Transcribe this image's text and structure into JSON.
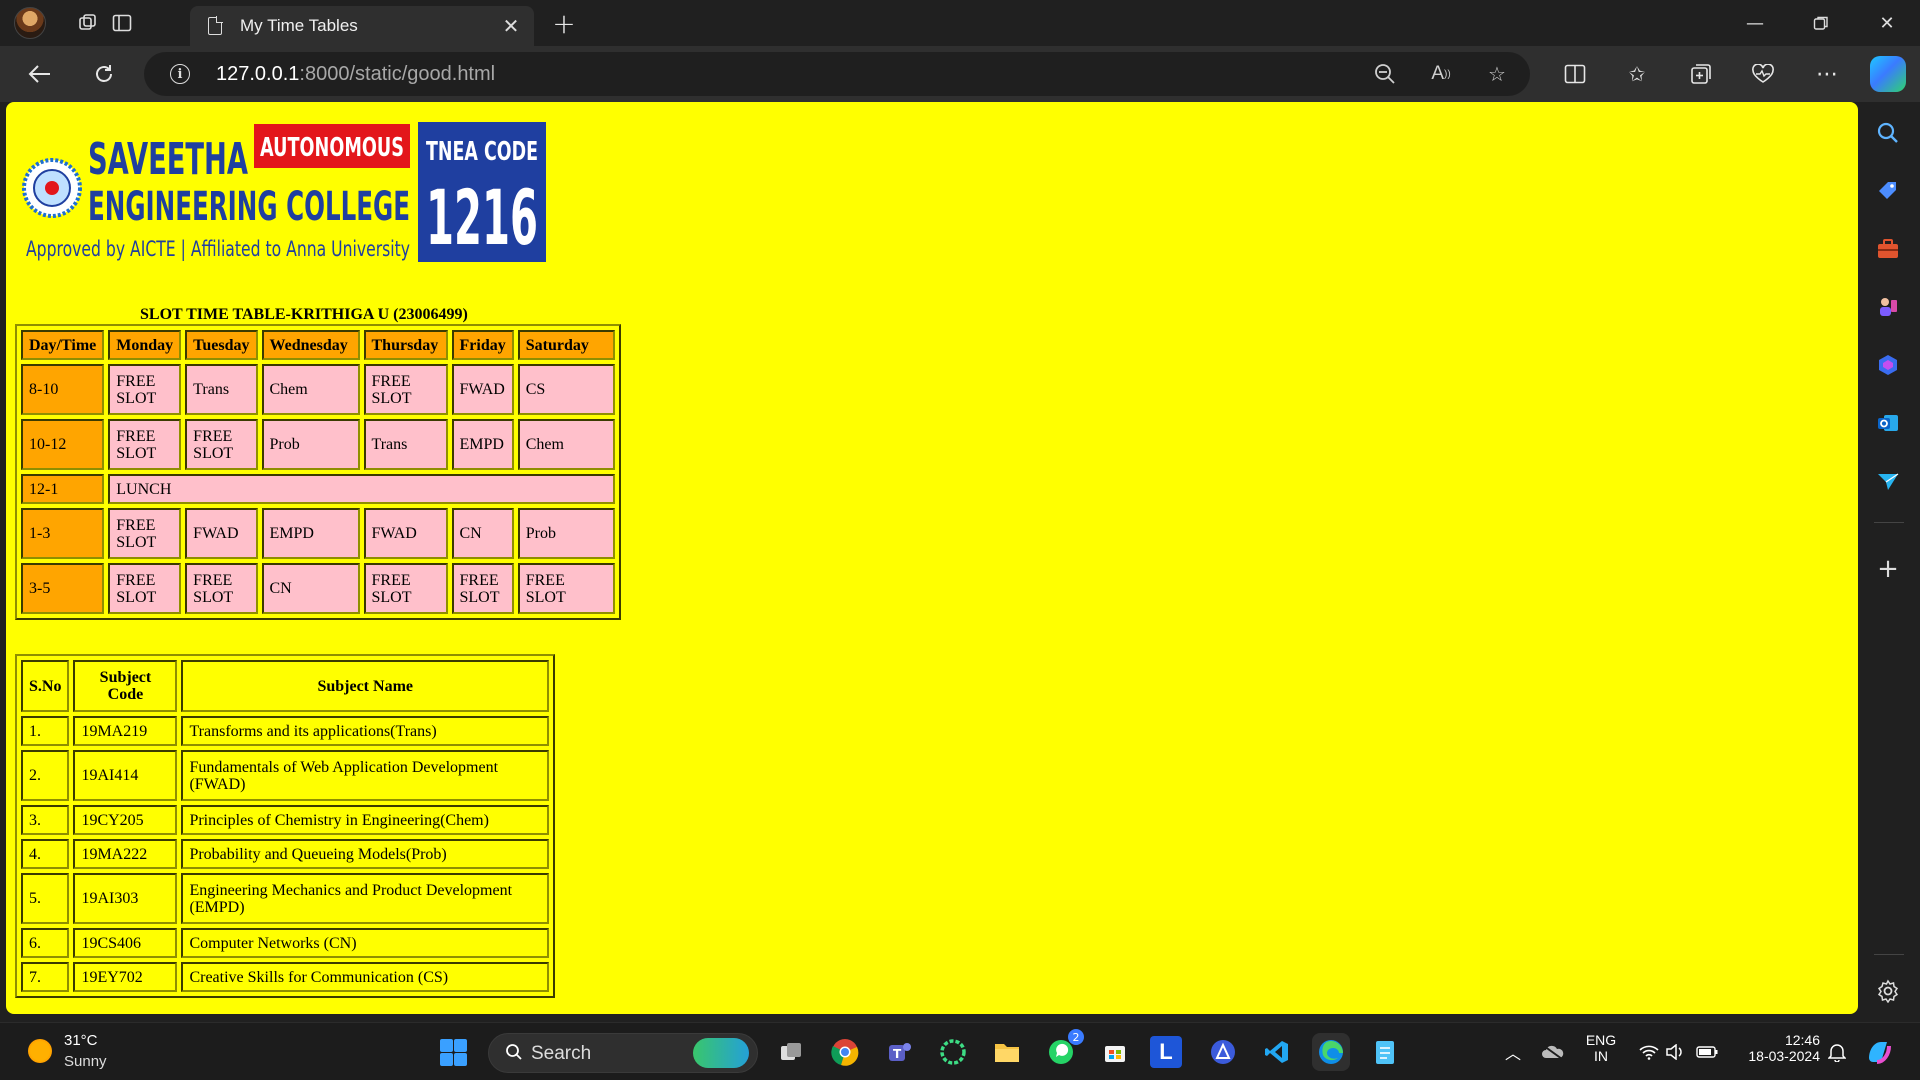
{
  "browser": {
    "tab_title": "My Time Tables",
    "url_host": "127.0.0.1",
    "url_path": ":8000/static/good.html"
  },
  "logo": {
    "name_line1": "SAVEETHA",
    "badge": "AUTONOMOUS",
    "name_line2": "ENGINEERING COLLEGE",
    "tagline": "Approved by AICTE | Affiliated to Anna University",
    "tnea_label": "TNEA CODE",
    "tnea_code": "1216"
  },
  "timetable": {
    "caption": "SLOT TIME TABLE-KRITHIGA U (23006499)",
    "headers": [
      "Day/Time",
      "Monday",
      "Tuesday",
      "Wednesday",
      "Thursday",
      "Friday",
      "Saturday"
    ],
    "rows": [
      {
        "time": "8-10",
        "cells": [
          "FREE SLOT",
          "Trans",
          "Chem",
          "FREE SLOT",
          "FWAD",
          "CS"
        ]
      },
      {
        "time": "10-12",
        "cells": [
          "FREE SLOT",
          "FREE SLOT",
          "Prob",
          "Trans",
          "EMPD",
          "Chem"
        ]
      },
      {
        "time": "12-1",
        "lunch": "LUNCH"
      },
      {
        "time": "1-3",
        "cells": [
          "FREE SLOT",
          "FWAD",
          "EMPD",
          "FWAD",
          "CN",
          "Prob"
        ]
      },
      {
        "time": "3-5",
        "cells": [
          "FREE SLOT",
          "FREE SLOT",
          "CN",
          "FREE SLOT",
          "FREE SLOT",
          "FREE SLOT"
        ]
      }
    ]
  },
  "subjects": {
    "headers": [
      "S.No",
      "Subject Code",
      "Subject Name"
    ],
    "rows": [
      {
        "sno": "1.",
        "code": "19MA219",
        "name": "Transforms and its applications(Trans)"
      },
      {
        "sno": "2.",
        "code": "19AI414",
        "name": "Fundamentals of Web Application Development (FWAD)"
      },
      {
        "sno": "3.",
        "code": "19CY205",
        "name": "Principles of Chemistry in Engineering(Chem)"
      },
      {
        "sno": "4.",
        "code": "19MA222",
        "name": "Probability and Queueing Models(Prob)"
      },
      {
        "sno": "5.",
        "code": "19AI303",
        "name": "Engineering Mechanics and Product Development (EMPD)"
      },
      {
        "sno": "6.",
        "code": "19CS406",
        "name": "Computer Networks (CN)"
      },
      {
        "sno": "7.",
        "code": "19EY702",
        "name": "Creative Skills for Communication (CS)"
      }
    ]
  },
  "taskbar": {
    "temperature": "31°C",
    "condition": "Sunny",
    "search_label": "Search",
    "lang_line1": "ENG",
    "lang_line2": "IN",
    "time": "12:46",
    "date": "18-03-2024",
    "whatsapp_badge": "2"
  },
  "colors": {
    "page_bg": "#ffff00",
    "header_cell": "#ffa500",
    "slot_cell": "#ffc0cb",
    "logo_blue": "#1f3fa0",
    "logo_red": "#e3161b"
  },
  "icons": [
    "back-icon",
    "refresh-icon",
    "info-icon",
    "zoom-out-icon",
    "read-aloud-icon",
    "favorite-star-icon",
    "split-screen-icon",
    "favorites-icon",
    "collections-icon",
    "browser-essentials-icon",
    "more-icon",
    "copilot-icon"
  ]
}
